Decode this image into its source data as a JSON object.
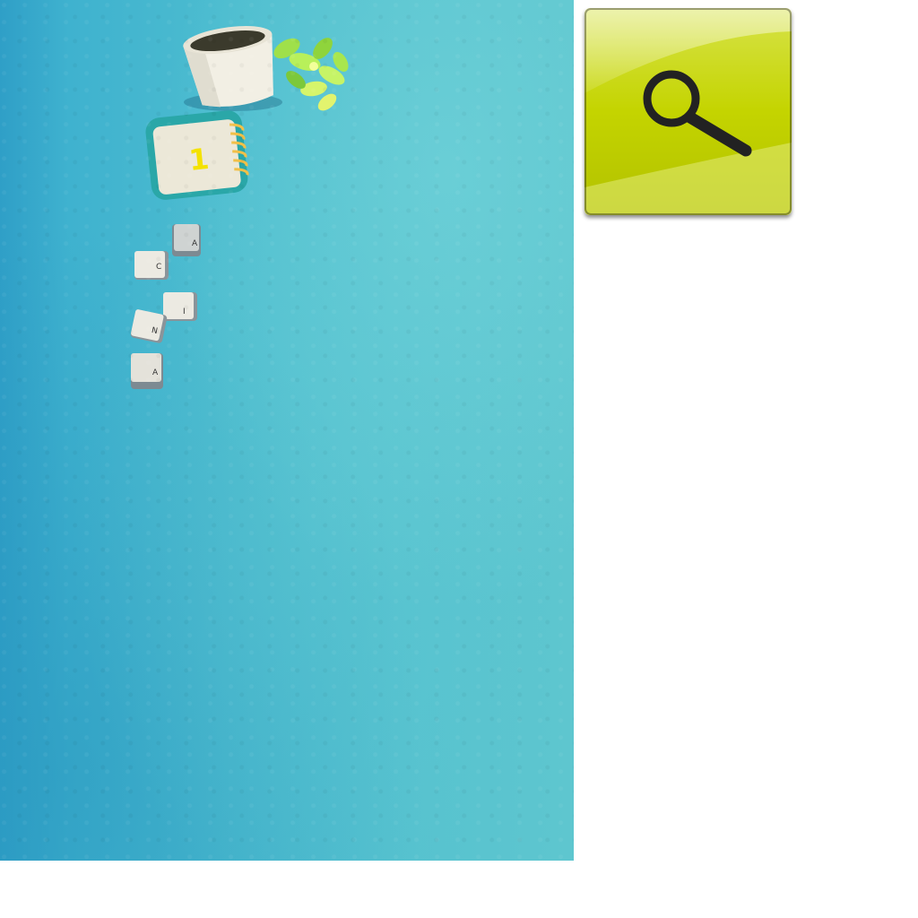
{
  "wallpaper": {
    "base_color": "#4cbccf",
    "notepad_number": "1",
    "keycaps": [
      "A",
      "C",
      "I",
      "N",
      "A"
    ]
  },
  "search_tile": {
    "icon": "magnifying-glass-icon",
    "accent_color": "#c4d400",
    "glyph_color": "#222222"
  }
}
